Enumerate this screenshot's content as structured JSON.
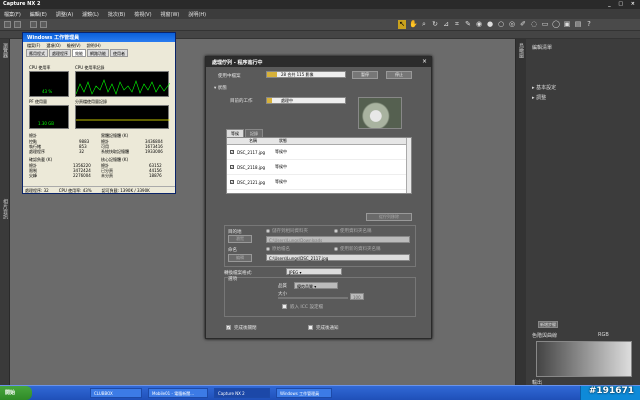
{
  "app": {
    "title": "Capture NX 2",
    "window_controls": "_ □ ×"
  },
  "menu": [
    "檔案(F)",
    "編輯(E)",
    "調整(A)",
    "濾鏡(L)",
    "批次(B)",
    "檢視(V)",
    "視窗(W)",
    "說明(H)"
  ],
  "left_sidebar": [
    "瀏覽器",
    "相片資訊"
  ],
  "right_panel": {
    "side_tab": "鳥瞰圖",
    "edit_list": "編輯清單",
    "items": [
      "基本設定",
      "調整"
    ],
    "apply_button": "新增步驟",
    "histogram_label": "色階與曲線",
    "channel": "RGB",
    "output_label": "輸出"
  },
  "taskmgr": {
    "title": "Windows 工作管理員",
    "menu": [
      "檔案(F)",
      "選項(O)",
      "檢視(V)",
      "說明(H)"
    ],
    "tabs": [
      "應用程式",
      "處理程序",
      "效能",
      "網路功能",
      "使用者"
    ],
    "cpu_usage_label": "CPU 使用率",
    "cpu_history_label": "CPU 使用率記錄",
    "cpu_value": "43 %",
    "pf_label": "PF 使用量",
    "pf_value": "1.30 GB",
    "pf_history_label": "分頁檔使用量記錄",
    "totals_label": "總計",
    "totals": [
      [
        "控點",
        "9883"
      ],
      [
        "執行緒",
        "853"
      ],
      [
        "處理程序",
        "32"
      ]
    ],
    "physmem_label": "實體記憶體 (K)",
    "physmem": [
      [
        "總計",
        "3436804"
      ],
      [
        "可用",
        "1673416"
      ],
      [
        "系統快取記憶體",
        "1933006"
      ]
    ],
    "commit_label": "確認負載 (K)",
    "commit": [
      [
        "總計",
        "1356220"
      ],
      [
        "限制",
        "3472424"
      ],
      [
        "尖峰",
        "2276004"
      ]
    ],
    "kernel_label": "核心記憶體 (K)",
    "kernel": [
      [
        "總計",
        "63152"
      ],
      [
        "已分頁",
        "44156"
      ],
      [
        "未分頁",
        "18876"
      ]
    ],
    "status": [
      "處理程序: 32",
      "CPU 使用率: 43%",
      "認可負載: 1390K / 3390K"
    ]
  },
  "dialog": {
    "title": "處理佇列 - 程序進行中",
    "in_use_label": "使用中檔案",
    "progress_text": "28 合共 115 影像",
    "pause_label": "暫停",
    "stop_label": "停止",
    "status_label": "狀態",
    "current_task_label": "目前的工作",
    "current_task": "處理中",
    "tabs": [
      "等候",
      "記錄"
    ],
    "list_headers": [
      "名稱",
      "狀態"
    ],
    "files": [
      {
        "name": "DSC_2117.jpg",
        "status": "等候中"
      },
      {
        "name": "DSC_2118.jpg",
        "status": "等候中"
      },
      {
        "name": "DSC_2121.jpg",
        "status": "等候中"
      }
    ],
    "clear_button": "從佇列移除",
    "dest_label": "目的地",
    "browse_button": "瀏覽",
    "dest_path": "C:\\Users\\Lungs\\Downloads",
    "opt_same_folder": "儲存到相同資料夾",
    "opt_diff_folder": "使用資料夾名稱",
    "rename_label": "命名",
    "rename_button": "編輯",
    "rename_path": "C:\\Users\\Lungs\\DSC_2117.jpg",
    "opt_original": "原始檔名",
    "opt_template": "使用新的資料夾名稱",
    "format_label": "轉換檔案格式:",
    "format_value": "JPEG",
    "settings_label": "選項",
    "quality_label": "品質",
    "quality_value": "優良品質",
    "size_label": "大小",
    "size_value": "100",
    "icc_label": "嵌入 ICC 設定檔",
    "close_on_finish": "完成後關閉",
    "notify_on_finish": "完成後通知"
  },
  "taskbar": {
    "start": "開始",
    "tasks": [
      "CLUBBOX",
      "Mobile01 - 電腦新聞...",
      "Capture NX 2",
      "Windows 工作管理員"
    ],
    "watermark": "#191671"
  }
}
